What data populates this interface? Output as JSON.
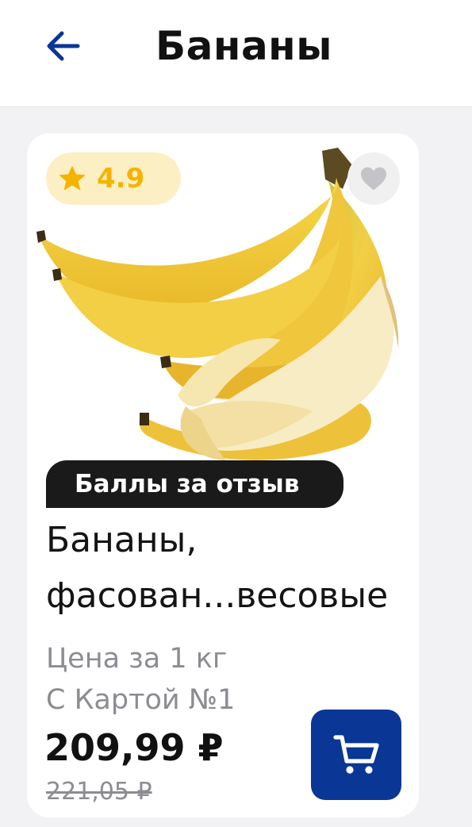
{
  "header": {
    "title": "Бананы",
    "back_icon": "arrow-left-icon",
    "accent_color": "#0a3696"
  },
  "product": {
    "image": "bananas-product-image",
    "rating": "4.9",
    "rating_icon": "star-icon",
    "favorite_icon": "heart-icon",
    "promo_label": "Баллы за отзыв",
    "name_line1": "Бананы,",
    "name_line2": "фасован...весовые",
    "price_unit": "Цена за 1 кг",
    "card_label": "С Картой №1",
    "price_current": "209,99 ₽",
    "price_old": "221,05 ₽",
    "cart_icon": "cart-icon"
  }
}
